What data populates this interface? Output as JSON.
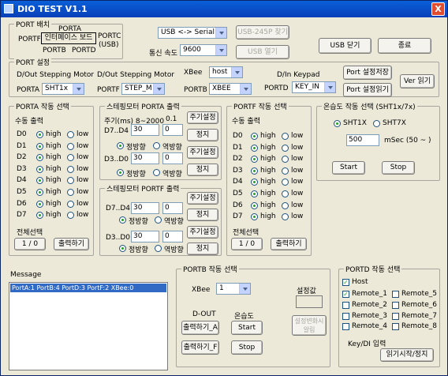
{
  "window": {
    "title": "DIO TEST V1.1",
    "close": "X"
  },
  "port_layout": {
    "label": "PORT 배치",
    "porta": "PORTA",
    "portf": "PORTF",
    "iface": "인터페이스 보드",
    "portc": "PORTC",
    "usb": "(USB)",
    "portb": "PORTB",
    "portd": "PORTD"
  },
  "comm": {
    "mode": "USB <-> Serial",
    "speed_label": "통신 속도",
    "speed": "9600",
    "find_btn": "USB-245P 찾기",
    "open_btn": "USB 열기",
    "close_usb_btn": "USB 닫기",
    "exit_btn": "종료"
  },
  "port_settings": {
    "label": "PORT 설정",
    "h1": "D/Out  Stepping Motor",
    "h2": "D/Out  Stepping Motor",
    "xbee_label": "XBee",
    "xbee_val": "host",
    "dinkey": "D/In  Keypad",
    "porta": "PORTA",
    "porta_val": "SHT1x",
    "portf": "PORTF",
    "portf_val": "STEP_M",
    "portb": "PORTB",
    "portb_val": "XBEE",
    "portd": "PORTD",
    "portd_val": "KEY_IN",
    "save_btn": "Port 설정저장",
    "read_btn": "Port 설정읽기",
    "ver_btn": "Ver 읽기"
  },
  "porta_panel": {
    "label": "PORTA 작동 선택",
    "sub": "수동 출력",
    "rows": [
      {
        "name": "D0",
        "high": "high",
        "low": "low"
      },
      {
        "name": "D1",
        "high": "high",
        "low": "low"
      },
      {
        "name": "D2",
        "high": "high",
        "low": "low"
      },
      {
        "name": "D3",
        "high": "high",
        "low": "low"
      },
      {
        "name": "D4",
        "high": "high",
        "low": "low"
      },
      {
        "name": "D5",
        "high": "high",
        "low": "low"
      },
      {
        "name": "D6",
        "high": "high",
        "low": "low"
      },
      {
        "name": "D7",
        "high": "high",
        "low": "low"
      }
    ],
    "all_label": "전체선택",
    "all_val": "1 / 0",
    "out_btn": "출력하기"
  },
  "step_a": {
    "label": "스테핑모터 PORTA 출력",
    "period": "주기(ms)  8~2000",
    "step": "0.1",
    "r1": "D7..D4",
    "r1_v1": "30",
    "r1_v2": "0",
    "r2": "D3..D0",
    "r2_v1": "30",
    "r2_v2": "0",
    "fwd": "정방향",
    "rev": "역방향",
    "set_btn": "주기설정",
    "stop_btn": "정지"
  },
  "step_f": {
    "label": "스테핑모터 PORTF 출력",
    "r1": "D7..D4",
    "r1_v1": "30",
    "r1_v2": "0",
    "r2": "D3..D0",
    "r2_v1": "30",
    "r2_v2": "0",
    "fwd": "정방향",
    "rev": "역방향",
    "set_btn": "주기설정",
    "stop_btn": "정지"
  },
  "portf_panel": {
    "label": "PORTF 작동 선택",
    "sub": "수동 출력",
    "rows": [
      {
        "name": "D0",
        "high": "high",
        "low": "low"
      },
      {
        "name": "D1",
        "high": "high",
        "low": "low"
      },
      {
        "name": "D2",
        "high": "high",
        "low": "low"
      },
      {
        "name": "D3",
        "high": "high",
        "low": "low"
      },
      {
        "name": "D4",
        "high": "high",
        "low": "low"
      },
      {
        "name": "D5",
        "high": "high",
        "low": "low"
      },
      {
        "name": "D6",
        "high": "high",
        "low": "low"
      },
      {
        "name": "D7",
        "high": "high",
        "low": "low"
      }
    ],
    "all_label": "전체선택",
    "all_val": "1 / 0",
    "out_btn": "출력하기"
  },
  "temp_panel": {
    "label": "온습도 작동 선택 (SHT1x/7x)",
    "opt1": "SHT1X",
    "opt2": "SHT7X",
    "period_val": "500",
    "period_unit": "mSec (50 ~ )",
    "start": "Start",
    "stop": "Stop"
  },
  "message": {
    "label": "Message",
    "line": "PortA:1 PortB:4 PortD:3 PortF:2 XBee:0"
  },
  "portb_panel": {
    "label": "PORTB 작동 선택",
    "xbee": "XBee",
    "xbee_val": "1",
    "dout": "D-OUT",
    "temp": "온습도",
    "out_a": "출력하기_A",
    "out_f": "출력하기_F",
    "start": "Start",
    "stop": "Stop",
    "setval_label": "설정값",
    "alert_btn": "설정변화시 알림"
  },
  "portd_panel": {
    "label": "PORTD 작동 선택",
    "host": "Host",
    "remotes": [
      "Remote_1",
      "Remote_5",
      "Remote_2",
      "Remote_6",
      "Remote_3",
      "Remote_7",
      "Remote_4",
      "Remote_8"
    ],
    "key_label": "Key/DI 입력",
    "read_btn": "읽기시작/정지"
  }
}
